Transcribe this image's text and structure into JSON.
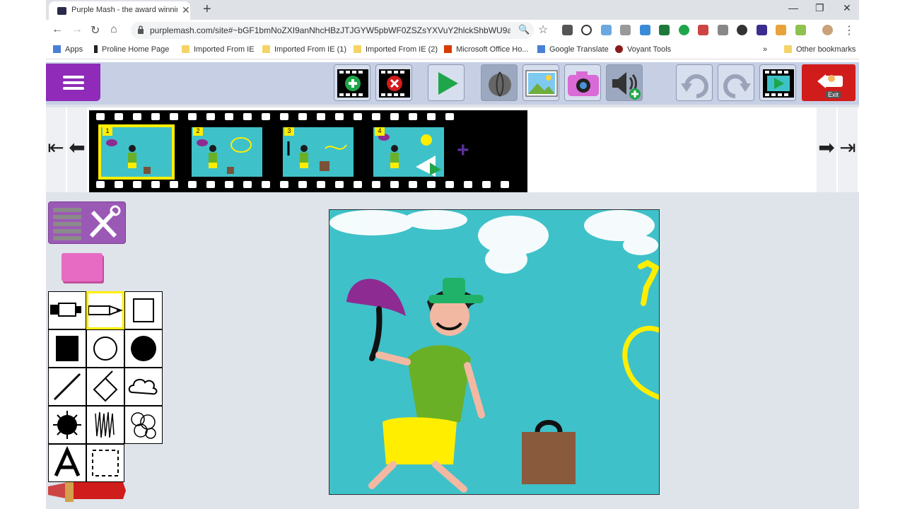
{
  "browser": {
    "tab_title": "Purple Mash - the award winning",
    "url": "purplemash.com/site#~bGF1bmNoZXI9anNhcHBzJTJGYW5pbWF0ZSZsYXVuY2hlckShbWU9an...",
    "bookmarks": [
      {
        "label": "Apps"
      },
      {
        "label": "Proline Home Page"
      },
      {
        "label": "Imported From IE"
      },
      {
        "label": "Imported From IE (1)"
      },
      {
        "label": "Imported From IE (2)"
      },
      {
        "label": "Microsoft Office Ho..."
      },
      {
        "label": "Google Translate"
      },
      {
        "label": "Voyant Tools"
      }
    ],
    "more_bookmarks": "»",
    "other_bookmarks": "Other bookmarks"
  },
  "app": {
    "exit_tooltip": "Exit",
    "frames": [
      {
        "number": "1"
      },
      {
        "number": "2"
      },
      {
        "number": "3"
      },
      {
        "number": "4"
      }
    ],
    "add_frame": "+"
  },
  "colors": {
    "menu": "#8f2bb8",
    "sky": "#3fc1c9",
    "exit": "#d11c1c",
    "selected": "#ffee00"
  }
}
